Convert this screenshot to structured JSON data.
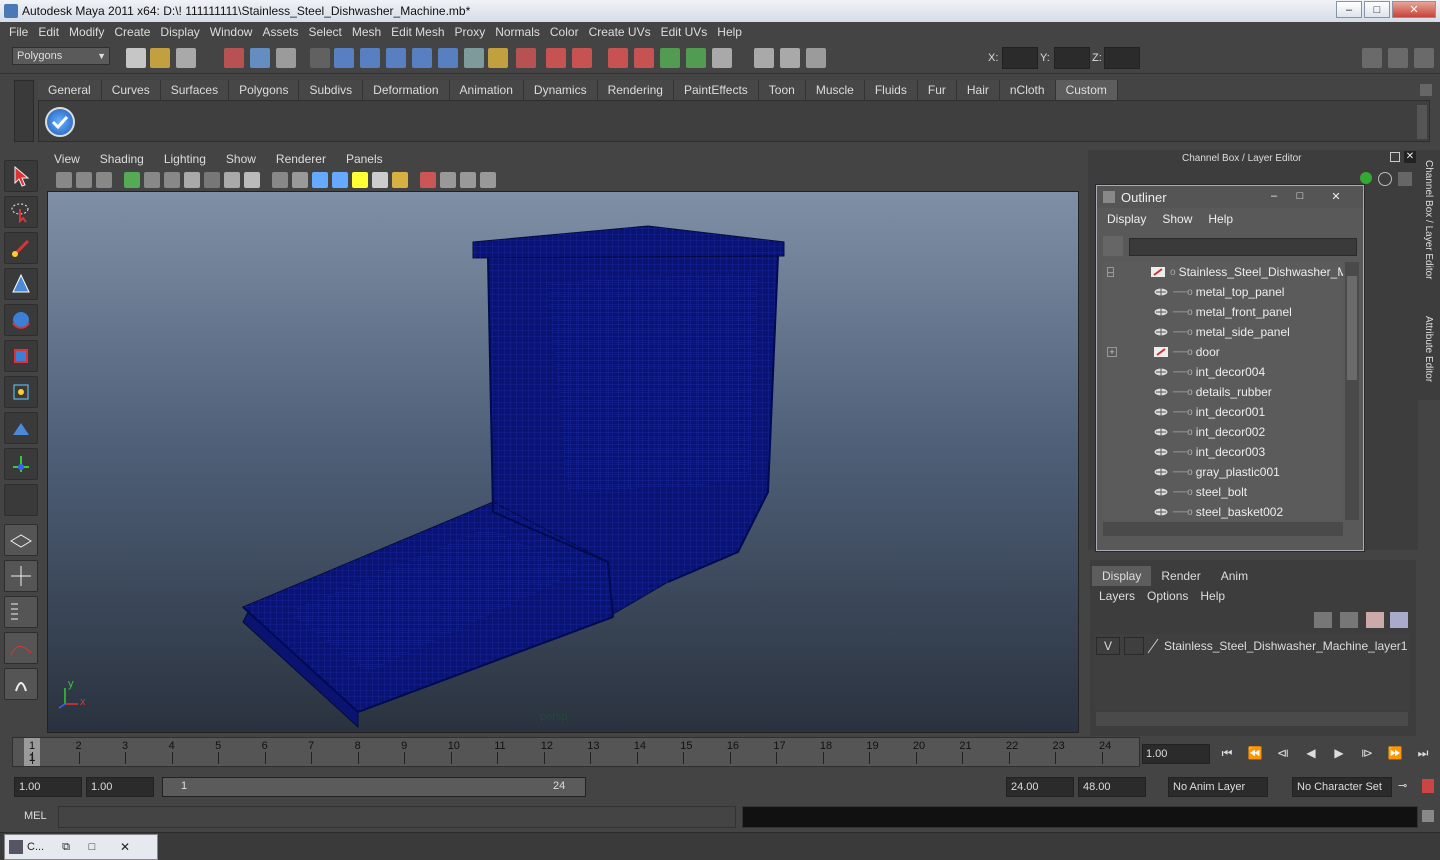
{
  "window": {
    "title": "Autodesk Maya 2011 x64: D:\\! 111111111\\Stainless_Steel_Dishwasher_Machine.mb*",
    "minimize": "–",
    "maximize": "□",
    "close": "✕"
  },
  "menubar": [
    "File",
    "Edit",
    "Modify",
    "Create",
    "Display",
    "Window",
    "Assets",
    "Select",
    "Mesh",
    "Edit Mesh",
    "Proxy",
    "Normals",
    "Color",
    "Create UVs",
    "Edit UVs",
    "Help"
  ],
  "status": {
    "mode": "Polygons",
    "x_label": "X:",
    "y_label": "Y:",
    "z_label": "Z:"
  },
  "shelf": {
    "tabs": [
      "General",
      "Curves",
      "Surfaces",
      "Polygons",
      "Subdivs",
      "Deformation",
      "Animation",
      "Dynamics",
      "Rendering",
      "PaintEffects",
      "Toon",
      "Muscle",
      "Fluids",
      "Fur",
      "Hair",
      "nCloth",
      "Custom"
    ],
    "active": "Custom"
  },
  "viewport": {
    "menu": [
      "View",
      "Shading",
      "Lighting",
      "Show",
      "Renderer",
      "Panels"
    ],
    "camera": "persp",
    "axis_y": "y",
    "axis_x": "x",
    "wireframe_color": "#0a1470"
  },
  "channel_box": {
    "label": "Channel Box / Layer Editor",
    "side_tabs": [
      "Channel Box / Layer Editor",
      "Attribute Editor"
    ]
  },
  "outliner": {
    "title": "Outliner",
    "menu": [
      "Display",
      "Show",
      "Help"
    ],
    "items": [
      {
        "name": "Stainless_Steel_Dishwasher_Mach",
        "type": "group",
        "expander": "–"
      },
      {
        "name": "metal_top_panel",
        "type": "mesh"
      },
      {
        "name": "metal_front_panel",
        "type": "mesh"
      },
      {
        "name": "metal_side_panel",
        "type": "mesh"
      },
      {
        "name": "door",
        "type": "group",
        "expander": "+"
      },
      {
        "name": "int_decor004",
        "type": "mesh"
      },
      {
        "name": "details_rubber",
        "type": "mesh"
      },
      {
        "name": "int_decor001",
        "type": "mesh"
      },
      {
        "name": "int_decor002",
        "type": "mesh"
      },
      {
        "name": "int_decor003",
        "type": "mesh"
      },
      {
        "name": "gray_plastic001",
        "type": "mesh"
      },
      {
        "name": "steel_bolt",
        "type": "mesh"
      },
      {
        "name": "steel_basket002",
        "type": "mesh"
      }
    ]
  },
  "layer_editor": {
    "tabs": [
      "Display",
      "Render",
      "Anim"
    ],
    "active": "Display",
    "menu": [
      "Layers",
      "Options",
      "Help"
    ],
    "layers": [
      {
        "visible": "V",
        "name": "Stainless_Steel_Dishwasher_Machine_layer1"
      }
    ]
  },
  "timeline": {
    "ticks": [
      "1",
      "2",
      "3",
      "4",
      "5",
      "6",
      "7",
      "8",
      "9",
      "10",
      "11",
      "12",
      "13",
      "14",
      "15",
      "16",
      "17",
      "18",
      "19",
      "20",
      "21",
      "22",
      "23",
      "24"
    ],
    "current_frame_marker": "1",
    "current_frame": "1.00"
  },
  "range": {
    "start": "1.00",
    "playback_start": "1.00",
    "slider_start": "1",
    "slider_end": "24",
    "playback_end": "24.00",
    "end": "48.00",
    "anim_layer": "No Anim Layer",
    "character_set": "No Character Set"
  },
  "command": {
    "label": "MEL"
  },
  "taskbar": {
    "label": "C..."
  },
  "playback": [
    "⏮",
    "⏪",
    "⧏",
    "◀",
    "▶",
    "⧐",
    "⏩",
    "⏭"
  ]
}
